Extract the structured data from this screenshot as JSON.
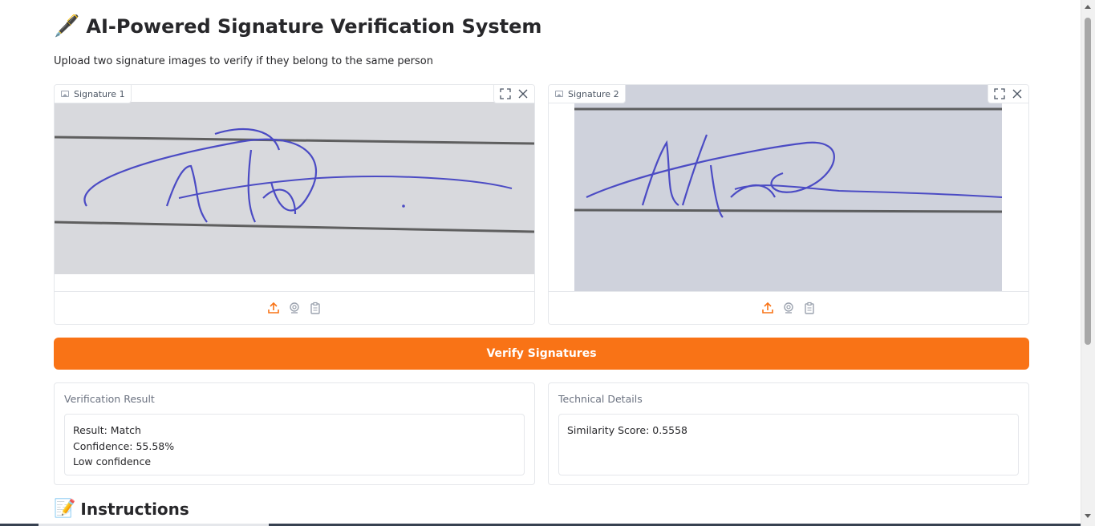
{
  "header": {
    "title": "AI-Powered Signature Verification System",
    "title_emoji": "🖋️",
    "subtitle": "Upload two signature images to verify if they belong to the same person"
  },
  "inputs": [
    {
      "label": "Signature 1",
      "icon": "image-icon",
      "signature_text": "Neha"
    },
    {
      "label": "Signature 2",
      "icon": "image-icon",
      "signature_text": "Neha"
    }
  ],
  "image_tools": [
    "fullscreen-icon",
    "close-icon"
  ],
  "source_tools": [
    "upload-icon",
    "webcam-icon",
    "clipboard-icon"
  ],
  "verify_button": {
    "label": "Verify Signatures"
  },
  "outputs": {
    "result": {
      "label": "Verification Result",
      "text": "Result: Match\nConfidence: 55.58%\nLow confidence"
    },
    "technical": {
      "label": "Technical Details",
      "text": "Similarity Score: 0.5558"
    }
  },
  "instructions": {
    "title": "Instructions",
    "emoji": "📝"
  },
  "colors": {
    "accent": "#f97316",
    "border": "#e5e7eb",
    "ink": "#4b4bc4",
    "paper": "#d9dade"
  }
}
